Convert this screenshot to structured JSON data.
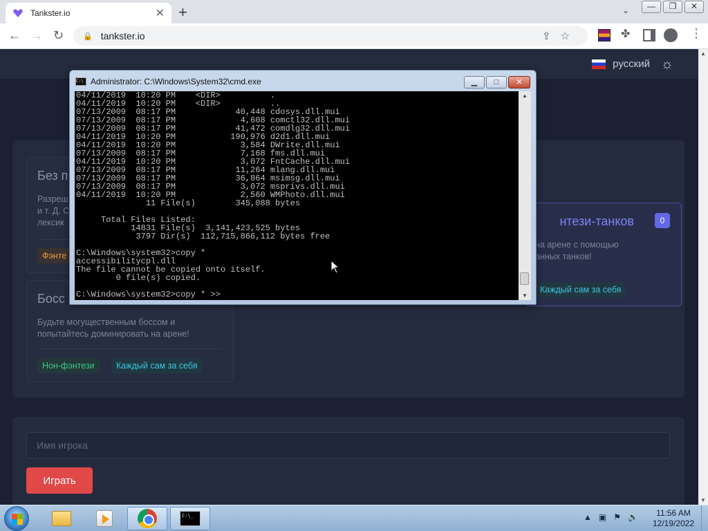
{
  "browser": {
    "tab_title": "Tankster.io",
    "url": "tankster.io"
  },
  "site": {
    "language": "русский",
    "cards": [
      {
        "title": "Без п",
        "desc_lines": [
          "Разреш",
          "и т. Д. С",
          "лексик"
        ],
        "tags": [
          "Фэнте"
        ]
      },
      {
        "title": "Босс",
        "desc_lines": [
          "Будьте могущественным боссом и",
          "попытайтесь доминировать на арене!"
        ],
        "tags": [
          "Нон-фэнтези",
          "Каждый сам за себя"
        ]
      },
      {
        "title": "нтези-танков",
        "badge": "0",
        "desc_lines": [
          "на арене с помощью",
          "анных танков!"
        ],
        "tags": [
          "Каждый сам за себя"
        ]
      }
    ],
    "player_name_placeholder": "Имя игрока",
    "play_button": "Играть"
  },
  "cmd": {
    "title": "Administrator: C:\\Windows\\System32\\cmd.exe",
    "lines": [
      "04/11/2019  10:20 PM    <DIR>          .",
      "04/11/2019  10:20 PM    <DIR>          ..",
      "07/13/2009  08:17 PM            40,448 cdosys.dll.mui",
      "07/13/2009  08:17 PM             4,608 comctl32.dll.mui",
      "07/13/2009  08:17 PM            41,472 comdlg32.dll.mui",
      "04/11/2019  10:20 PM           190,976 d2d1.dll.mui",
      "04/11/2019  10:20 PM             3,584 DWrite.dll.mui",
      "07/13/2009  08:17 PM             7,168 fms.dll.mui",
      "04/11/2019  10:20 PM             3,072 FntCache.dll.mui",
      "07/13/2009  08:17 PM            11,264 mlang.dll.mui",
      "07/13/2009  08:17 PM            36,864 msimsg.dll.mui",
      "07/13/2009  08:17 PM             3,072 msprivs.dll.mui",
      "04/11/2019  10:20 PM             2,560 WMPhoto.dll.mui",
      "              11 File(s)        345,088 bytes",
      "",
      "     Total Files Listed:",
      "           14831 File(s)  3,141,423,525 bytes",
      "            3797 Dir(s)  112,715,866,112 bytes free",
      "",
      "C:\\Windows\\system32>copy *",
      "accessibilitycpl.dll",
      "The file cannot be copied onto itself.",
      "        0 file(s) copied.",
      "",
      "C:\\Windows\\system32>copy * >>"
    ]
  },
  "taskbar": {
    "time": "11:56 AM",
    "date": "12/19/2022"
  }
}
